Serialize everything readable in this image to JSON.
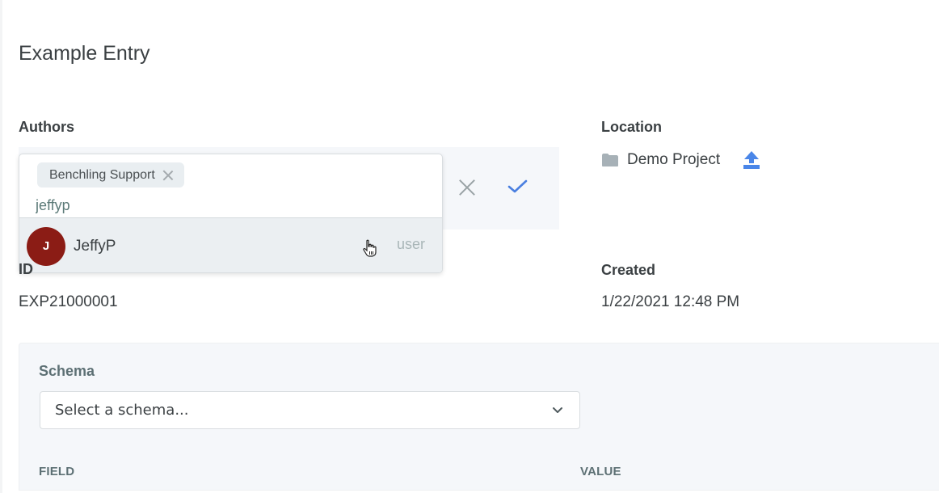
{
  "page": {
    "title": "Example Entry"
  },
  "authors": {
    "label": "Authors",
    "selected_chips": [
      {
        "label": "Benchling Support"
      }
    ],
    "search_value": "jeffyp",
    "options": [
      {
        "initial": "J",
        "name": "JeffyP",
        "type": "user",
        "avatar_color": "#8b1c15"
      }
    ],
    "cancel_icon": "close-icon",
    "confirm_icon": "check-icon"
  },
  "location": {
    "label": "Location",
    "value": "Demo Project",
    "folder_icon": "folder-icon",
    "move_icon": "upload-icon"
  },
  "id": {
    "label": "ID",
    "value": "EXP21000001"
  },
  "created": {
    "label": "Created",
    "value": "1/22/2021 12:48 PM"
  },
  "schema": {
    "label": "Schema",
    "select_placeholder": "Select a schema...",
    "columns": [
      "FIELD",
      "VALUE"
    ]
  },
  "colors": {
    "accent": "#4a7fe0",
    "folder": "#a7b1b7",
    "panel_bg": "#f5f7fa"
  }
}
